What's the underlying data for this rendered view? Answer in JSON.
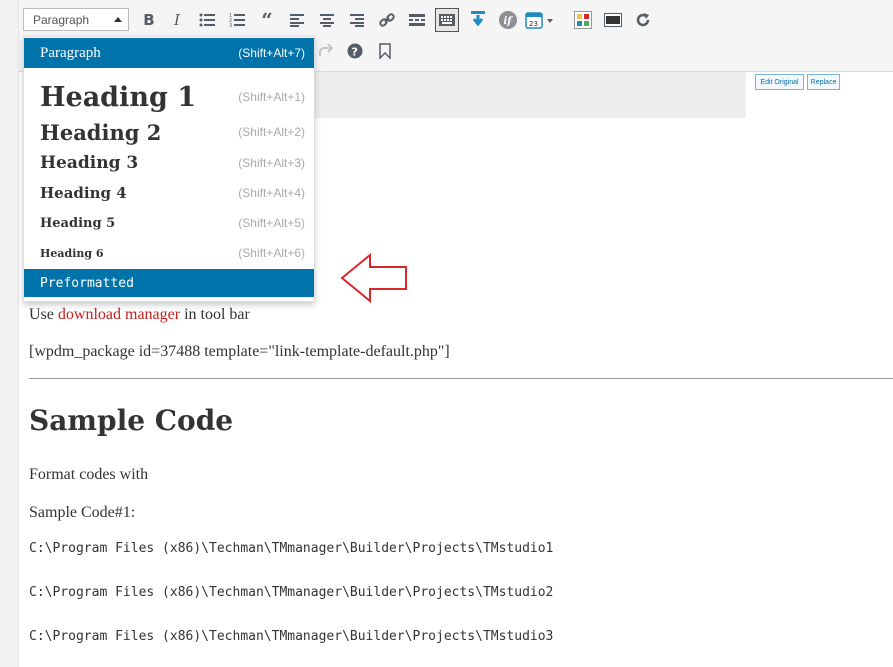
{
  "toolbar": {
    "format_select_value": "Paragraph",
    "icons_row1": [
      "bold-icon",
      "italic-icon",
      "bulleted-list-icon",
      "numbered-list-icon",
      "blockquote-icon",
      "align-left-icon",
      "align-center-icon",
      "align-right-icon",
      "link-icon",
      "read-more-icon",
      "toolbar-toggle-icon",
      "download-manager-icon",
      "shortcode-if-icon",
      "calendar-icon",
      "color-palette-icon",
      "video-embed-icon",
      "refresh-icon"
    ],
    "icons_row2": [
      "redo-icon",
      "help-icon",
      "bookmark-icon"
    ],
    "calendar_day": "23",
    "if_label": "if"
  },
  "format_dropdown": {
    "items": [
      {
        "label": "Paragraph",
        "shortcut": "(Shift+Alt+7)",
        "selected": true
      },
      {
        "label": "Heading 1",
        "shortcut": "(Shift+Alt+1)",
        "selected": false
      },
      {
        "label": "Heading 2",
        "shortcut": "(Shift+Alt+2)",
        "selected": false
      },
      {
        "label": "Heading 3",
        "shortcut": "(Shift+Alt+3)",
        "selected": false
      },
      {
        "label": "Heading 4",
        "shortcut": "(Shift+Alt+4)",
        "selected": false
      },
      {
        "label": "Heading 5",
        "shortcut": "(Shift+Alt+5)",
        "selected": false
      },
      {
        "label": "Heading 6",
        "shortcut": "(Shift+Alt+6)",
        "selected": false
      },
      {
        "label": "Preformatted",
        "shortcut": "",
        "selected": true
      }
    ]
  },
  "media_buttons": {
    "edit_original": "Edit Original",
    "replace": "Replace"
  },
  "content": {
    "use_prefix": "Use ",
    "use_link": "download manager",
    "use_suffix": " in tool bar",
    "shortcode": "[wpdm_package id=37488 template=\"link-template-default.php\"]",
    "heading": "Sample Code",
    "format_text": "Format codes with",
    "sample_label": "Sample Code#1:",
    "code_lines": [
      "C:\\Program Files (x86)\\Techman\\TMmanager\\Builder\\Projects\\TMstudio1",
      "C:\\Program Files (x86)\\Techman\\TMmanager\\Builder\\Projects\\TMstudio2",
      "C:\\Program Files (x86)\\Techman\\TMmanager\\Builder\\Projects\\TMstudio3"
    ]
  },
  "colors": {
    "accent": "#0073aa",
    "link_red": "#c81e1e",
    "arrow_red": "#d9272e"
  }
}
